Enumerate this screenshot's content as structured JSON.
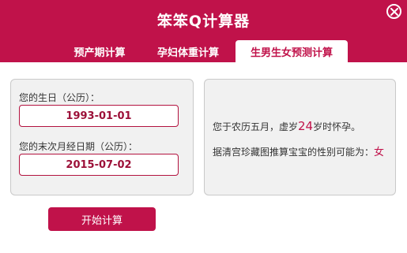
{
  "app": {
    "title": "笨笨Q计算器"
  },
  "tabs": [
    {
      "label": "预产期计算"
    },
    {
      "label": "孕妇体重计算"
    },
    {
      "label": "生男生女预测计算"
    }
  ],
  "form": {
    "birthday_label": "您的生日（公历）：",
    "birthday_value": "1993-01-01",
    "period_label": "您的末次月经日期（公历）：",
    "period_value": "2015-07-02"
  },
  "result": {
    "line1_prefix": "您于农历五月，虚岁",
    "age": "24",
    "line1_suffix": "岁时怀孕。",
    "line2_prefix": "据清宫珍藏图推算宝宝的性别可能为：",
    "gender": "女"
  },
  "buttons": {
    "start": "开始计算"
  },
  "colors": {
    "brand": "#c0124a",
    "panel_bg": "#f1f1f1"
  },
  "icons": {
    "close": "close-icon"
  }
}
